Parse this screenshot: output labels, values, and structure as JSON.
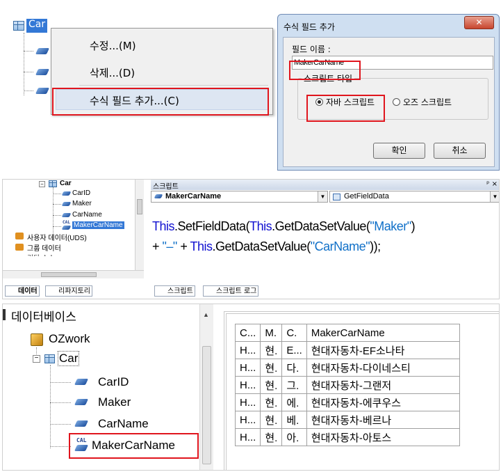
{
  "top": {
    "table_label": "Car",
    "menu": {
      "items": [
        "수정...(M)",
        "삭제...(D)",
        "수식 필드 추가...(C)"
      ]
    },
    "dialog": {
      "title": "수식 필드 추가",
      "close_glyph": "✕",
      "field_name_label": "필드 이름 :",
      "field_name_value": "MakerCarName",
      "script_type_label": "스크립트 타입",
      "option_java": "자바 스크립트",
      "option_oz": "오즈 스크립트",
      "ok": "확인",
      "cancel": "취소"
    }
  },
  "middle": {
    "tree": {
      "table": "Car",
      "fields": [
        "CarID",
        "Maker",
        "CarName",
        "MakerCarName"
      ],
      "uds": "사용자 데이터(UDS)",
      "group": "그룹 데이터",
      "partial": "기타 소스 ..."
    },
    "left_tabs": [
      "데이터",
      "리파지토리"
    ],
    "script_panel": {
      "title": "스크립트",
      "pin_close": "ᵖ ×",
      "field_select": "MakerCarName",
      "method_select": "GetFieldData",
      "code_line1": [
        "This",
        ".SetFieldData(",
        "This",
        ".GetDataSetValue(",
        "\"Maker\"",
        ")"
      ],
      "code_line2": [
        "+ ",
        "\"–\"",
        " + ",
        "This",
        ".GetDataSetValue(",
        "\"CarName\"",
        "));"
      ]
    },
    "right_tabs": [
      "스크립트",
      "스크립트 로그"
    ]
  },
  "bottom": {
    "tree": {
      "root": "데이터베이스",
      "db": "OZwork",
      "table": "Car",
      "fields": [
        "CarID",
        "Maker",
        "CarName",
        "MakerCarName"
      ]
    },
    "grid": {
      "headers": [
        "C...",
        "M.",
        "C.",
        "MakerCarName"
      ],
      "rows": [
        [
          "H...",
          "현.",
          "E...",
          "현대자동차-EF소나타"
        ],
        [
          "H...",
          "현.",
          "다.",
          "현대자동차-다이네스티"
        ],
        [
          "H...",
          "현.",
          "그.",
          "현대자동차-그랜저"
        ],
        [
          "H...",
          "현.",
          "에.",
          "현대자동차-에쿠우스"
        ],
        [
          "H...",
          "현.",
          "베.",
          "현대자동차-베르나"
        ],
        [
          "H...",
          "현.",
          "아.",
          "현대자동차-아토스"
        ]
      ]
    }
  },
  "colors": {
    "highlight_red": "#e0151d",
    "keyword_blue": "#1010d0",
    "string_blue": "#1070c8"
  }
}
